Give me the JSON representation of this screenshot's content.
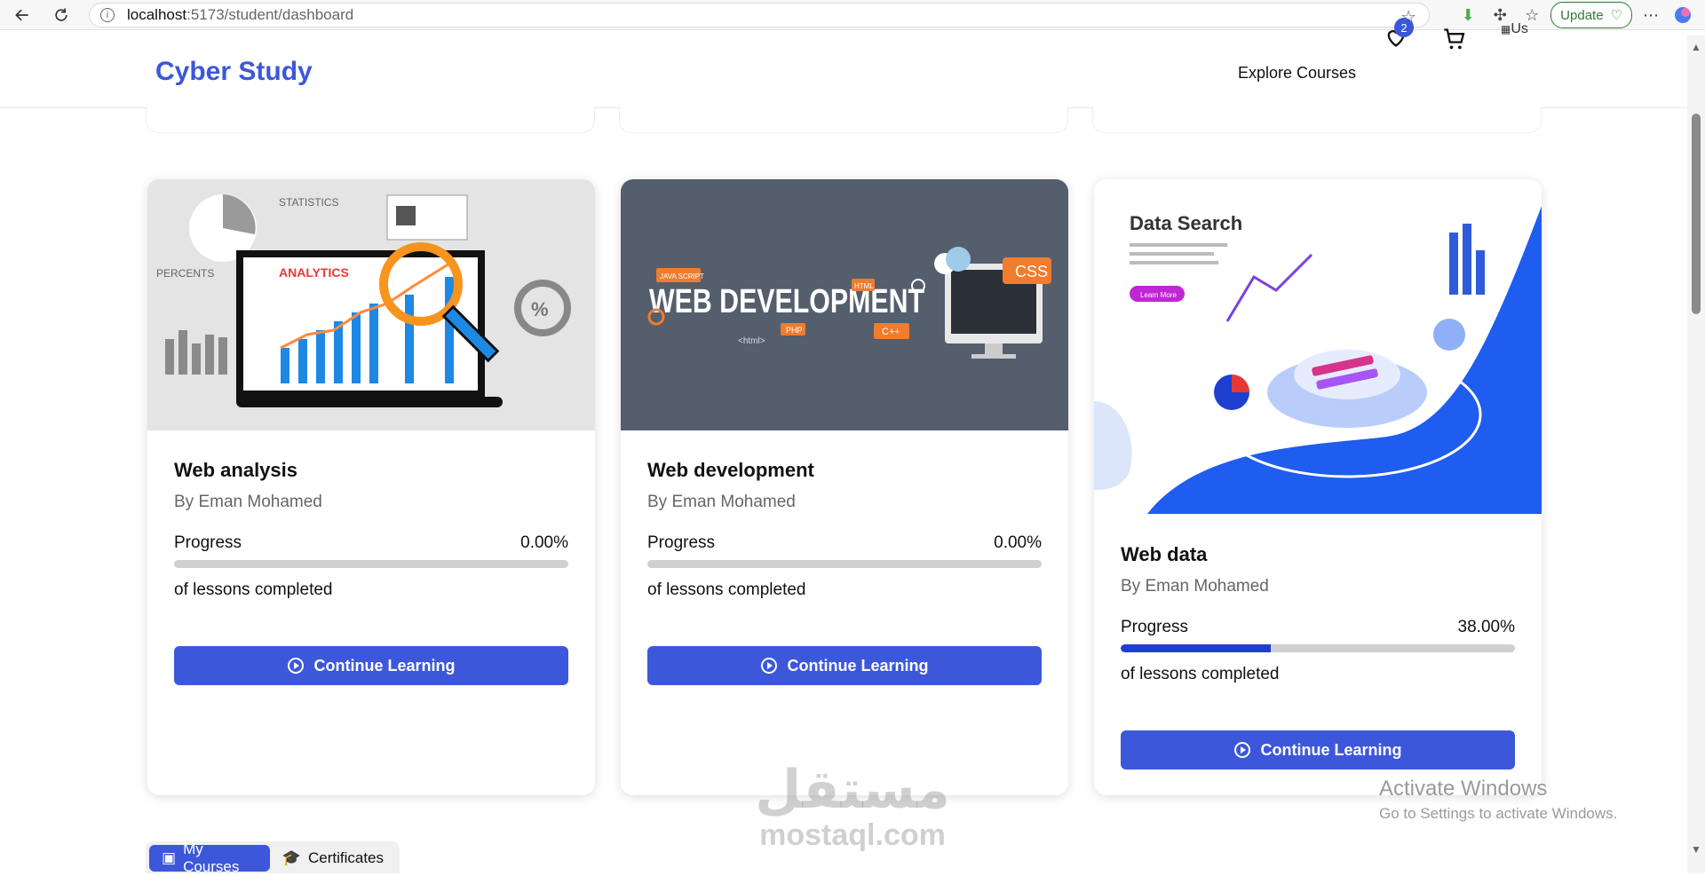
{
  "browser": {
    "url_host": "localhost",
    "url_path": ":5173/student/dashboard",
    "update_label": "Update"
  },
  "header": {
    "brand": "Cyber Study",
    "explore_label": "Explore Courses",
    "wishlist_count": "2",
    "avatar_alt": "Us"
  },
  "courses": [
    {
      "title": "Web analysis",
      "author": "By Eman Mohamed",
      "progress_label": "Progress",
      "progress_value": "0.00%",
      "progress_fraction": 0.0,
      "lessons_text": "of lessons completed",
      "button_label": "Continue Learning",
      "thumb_text": [
        "STATISTICS",
        "PERCENTS",
        "ANALYTICS"
      ]
    },
    {
      "title": "Web development",
      "author": "By Eman Mohamed",
      "progress_label": "Progress",
      "progress_value": "0.00%",
      "progress_fraction": 0.0,
      "lessons_text": "of lessons completed",
      "button_label": "Continue Learning",
      "thumb_text": [
        "WEB DEVELOPMENT",
        "CSS",
        "<html>",
        "PHP",
        "C++",
        "JAVA SCRIPT",
        "HTML"
      ]
    },
    {
      "title": "Web data",
      "author": "By Eman Mohamed",
      "progress_label": "Progress",
      "progress_value": "38.00%",
      "progress_fraction": 0.38,
      "lessons_text": "of lessons completed",
      "button_label": "Continue Learning",
      "thumb_text": [
        "Data Search",
        "Learn More"
      ]
    }
  ],
  "tabs": [
    {
      "label": "My Courses",
      "active": true
    },
    {
      "label": "Certificates",
      "active": false
    }
  ],
  "watermark": {
    "activate_title": "Activate Windows",
    "activate_sub": "Go to Settings to activate Windows.",
    "site_ar": "مستقل",
    "site_en": "mostaql.com"
  },
  "colors": {
    "brand": "#3b57d9",
    "button": "#3d57db",
    "progress_fill": "#1f3fd1",
    "progress_track": "#d0d0d0"
  }
}
